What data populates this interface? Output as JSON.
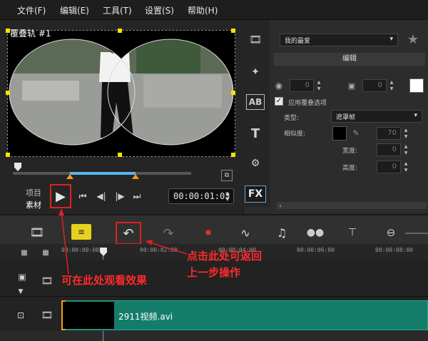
{
  "menubar": {
    "items": [
      "文件(F)",
      "编辑(E)",
      "工具(T)",
      "设置(S)",
      "帮助(H)"
    ]
  },
  "preview": {
    "title": "覆叠轨 #1",
    "mode_project": "项目",
    "mode_clip": "素材",
    "timecode": "00:00:01:03"
  },
  "options": {
    "preset": "我的最爱",
    "edit_tab": "编辑",
    "spin1": "0",
    "spin2": "0",
    "apply_overlay_label": "应用覆叠选项",
    "type_label": "类型:",
    "type_value": "遮罩帧",
    "similarity_label": "相似度:",
    "similarity_value": "70",
    "width_label": "宽度:",
    "width_value": "0",
    "height_label": "高度:",
    "height_value": "0"
  },
  "timeline": {
    "ticks": [
      "00:00:00:00",
      "00:00:02:00",
      "00:00:04:00",
      "00:00:06:00",
      "00:00:08:00"
    ],
    "clip_name": "2911视频.avi"
  },
  "annotations": {
    "play_note": "可在此处观看效果",
    "undo_note_line1": "点击此处可返回",
    "undo_note_line2": "上一步操作"
  },
  "colors": {
    "accent": "#e02020",
    "clip": "#137d6a",
    "trim": "#55b6ee"
  }
}
